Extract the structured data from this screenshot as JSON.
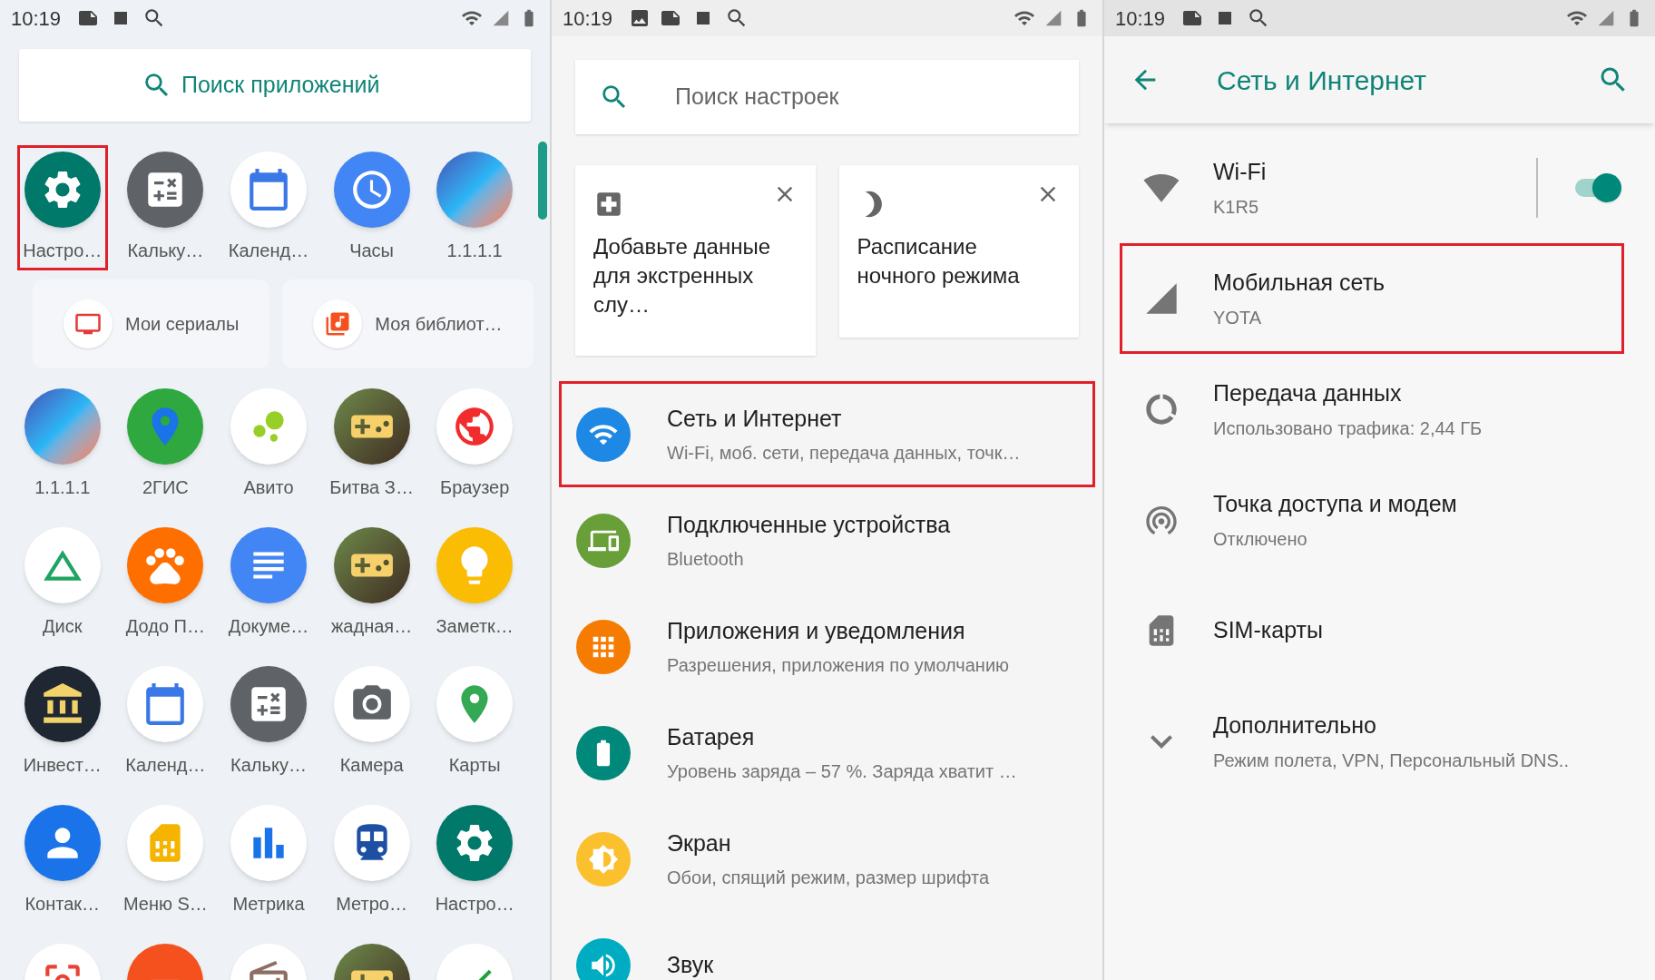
{
  "launcher": {
    "status_bar": {
      "time": "10:19"
    },
    "search": {
      "placeholder": "Поиск приложений"
    },
    "apps": [
      {
        "label": "Настро…",
        "kind": "settings",
        "highlighted": true
      },
      {
        "label": "Кальку…",
        "kind": "calculator",
        "highlighted": false
      },
      {
        "label": "Календ…",
        "kind": "calendar",
        "highlighted": false
      },
      {
        "label": "Часы",
        "kind": "clock",
        "highlighted": false
      },
      {
        "label": "1.1.1.1",
        "kind": "warp",
        "highlighted": false
      },
      {
        "label": "1.1.1.1",
        "kind": "warp",
        "highlighted": false
      },
      {
        "label": "2ГИС",
        "kind": "gis",
        "highlighted": false
      },
      {
        "label": "Авито",
        "kind": "avito",
        "highlighted": false
      },
      {
        "label": "Битва З…",
        "kind": "game",
        "highlighted": false
      },
      {
        "label": "Браузер",
        "kind": "browser",
        "highlighted": false
      },
      {
        "label": "Диск",
        "kind": "drive",
        "highlighted": false
      },
      {
        "label": "Додо П…",
        "kind": "dodo",
        "highlighted": false
      },
      {
        "label": "Докуме…",
        "kind": "docs",
        "highlighted": false
      },
      {
        "label": "жадная…",
        "kind": "game",
        "highlighted": false
      },
      {
        "label": "Заметк…",
        "kind": "keep",
        "highlighted": false
      },
      {
        "label": "Инвест…",
        "kind": "bank",
        "highlighted": false
      },
      {
        "label": "Календ…",
        "kind": "calendar",
        "highlighted": false
      },
      {
        "label": "Кальку…",
        "kind": "calculator",
        "highlighted": false
      },
      {
        "label": "Камера",
        "kind": "camera",
        "highlighted": false
      },
      {
        "label": "Карты",
        "kind": "maps",
        "highlighted": false
      },
      {
        "label": "Контак…",
        "kind": "contacts",
        "highlighted": false
      },
      {
        "label": "Меню S…",
        "kind": "sim",
        "highlighted": false
      },
      {
        "label": "Метрика",
        "kind": "metrica",
        "highlighted": false
      },
      {
        "label": "Метро…",
        "kind": "metro",
        "highlighted": false
      },
      {
        "label": "Настро…",
        "kind": "settings",
        "highlighted": false
      },
      {
        "kind": "lens",
        "highlighted": false
      },
      {
        "kind": "orange",
        "highlighted": false
      },
      {
        "kind": "radio",
        "highlighted": false
      },
      {
        "kind": "game",
        "highlighted": false
      },
      {
        "kind": "sber",
        "highlighted": false
      }
    ],
    "suggestions": [
      {
        "label": "Мои сериалы",
        "kind": "tv"
      },
      {
        "label": "Моя библиот…",
        "kind": "music"
      }
    ]
  },
  "settings": {
    "status_bar": {
      "time": "10:19"
    },
    "search": {
      "placeholder": "Поиск настроек"
    },
    "cards": [
      {
        "text": "Добавьте данные для экстренных слу…",
        "kind": "medical"
      },
      {
        "text": "Расписание ночного режима",
        "kind": "moon"
      }
    ],
    "items": [
      {
        "title": "Сеть и Интернет",
        "subtitle": "Wi-Fi, моб. сети, передача данных, точк…",
        "kind": "network",
        "highlighted": true
      },
      {
        "title": "Подключенные устройства",
        "subtitle": "Bluetooth",
        "kind": "devices",
        "highlighted": false
      },
      {
        "title": "Приложения и уведомления",
        "subtitle": "Разрешения, приложения по умолчанию",
        "kind": "apps",
        "highlighted": false
      },
      {
        "title": "Батарея",
        "subtitle": "Уровень заряда – 57 %. Заряда хватит …",
        "kind": "battery",
        "highlighted": false
      },
      {
        "title": "Экран",
        "subtitle": "Обои, спящий режим, размер шрифта",
        "kind": "display",
        "highlighted": false
      },
      {
        "title": "Звук",
        "kind": "sound",
        "highlighted": false
      }
    ]
  },
  "network": {
    "status_bar": {
      "time": "10:19"
    },
    "toolbar": {
      "title": "Сеть и Интернет"
    },
    "items": [
      {
        "title": "Wi-Fi",
        "subtitle": "K1R5",
        "kind": "wifi",
        "on": true,
        "highlighted": false
      },
      {
        "title": "Мобильная сеть",
        "subtitle": "YOTA",
        "kind": "mobile",
        "highlighted": true
      },
      {
        "title": "Передача данных",
        "subtitle": "Использовано трафика: 2,44 ГБ",
        "kind": "data",
        "highlighted": false
      },
      {
        "title": "Точка доступа и модем",
        "subtitle": "Отключено",
        "kind": "hotspot",
        "highlighted": false
      },
      {
        "title": "SIM-карты",
        "kind": "sim",
        "highlighted": false
      },
      {
        "title": "Дополнительно",
        "subtitle": "Режим полета, VPN, Персональный DNS..",
        "kind": "more",
        "highlighted": false
      }
    ]
  }
}
